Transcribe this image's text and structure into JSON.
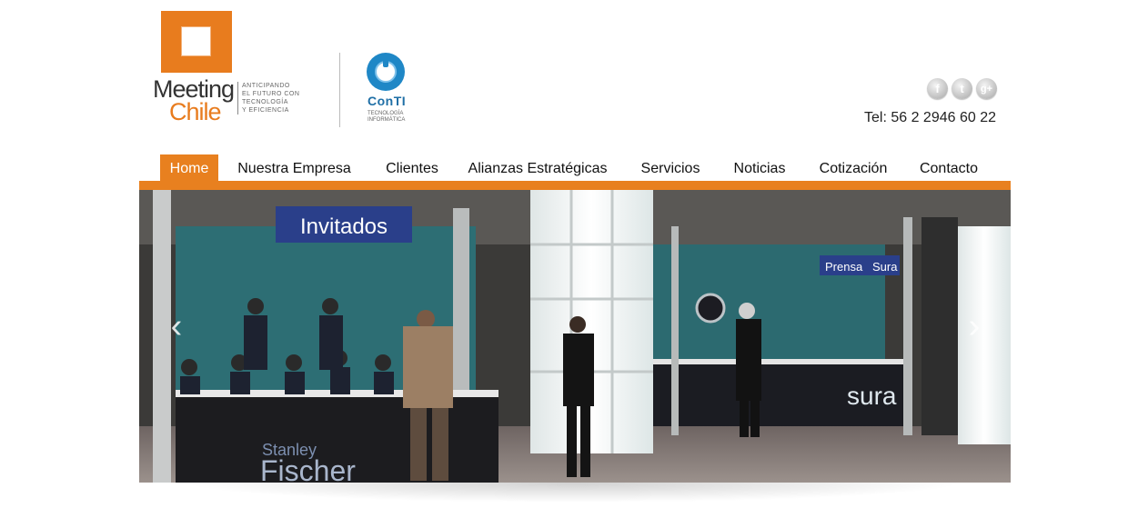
{
  "header": {
    "meeting_chile_logo": {
      "word1": "Meeting",
      "word2": "Chile",
      "tagline": [
        "ANTICIPANDO",
        "EL FUTURO CON",
        "TECNOLOGÍA",
        "Y EFICIENCIA"
      ]
    },
    "conti_logo": {
      "name": "ConTI",
      "sub": [
        "TECNOLOGÍA",
        "INFORMÁTICA"
      ]
    },
    "social": [
      {
        "icon": "facebook-icon",
        "glyph": "f"
      },
      {
        "icon": "twitter-icon",
        "glyph": "t"
      },
      {
        "icon": "google-plus-icon",
        "glyph": "g+"
      }
    ],
    "phone": "Tel: 56 2 2946 60 22"
  },
  "nav": {
    "items": [
      {
        "label": "Home",
        "active": true
      },
      {
        "label": "Nuestra Empresa",
        "active": false
      },
      {
        "label": "Clientes",
        "active": false
      },
      {
        "label": "Alianzas Estratégicas",
        "active": false
      },
      {
        "label": "Servicios",
        "active": false
      },
      {
        "label": "Noticias",
        "active": false
      },
      {
        "label": "Cotización",
        "active": false
      },
      {
        "label": "Contacto",
        "active": false
      }
    ]
  },
  "slider": {
    "prev_glyph": "‹",
    "next_glyph": "›",
    "photo_signs": {
      "invitados": "Invitados",
      "prensa": "Prensa",
      "sura_small": "Sura",
      "sura_big": "sura",
      "banner_line1": "Stanley",
      "banner_line2": "Fischer"
    }
  },
  "colors": {
    "accent": "#e8801f",
    "conti_blue": "#1f87c6"
  }
}
